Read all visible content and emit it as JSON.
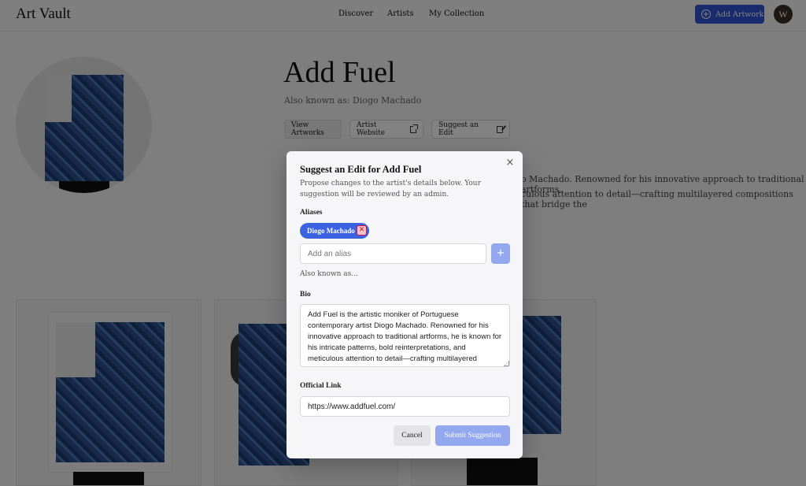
{
  "app": {
    "brand": "Art Vault",
    "avatar_initial": "W"
  },
  "nav": {
    "discover": "Discover",
    "artists": "Artists",
    "collection": "My Collection",
    "add_artwork": "Add Artwork"
  },
  "artist": {
    "name": "Add Fuel",
    "aka": "Also known as: Diogo Machado",
    "view_artworks": "View Artworks",
    "website": "Artist Website",
    "suggest_edit": "Suggest an Edit",
    "bio_visible_1": "o Machado. Renowned for his innovative approach to traditional artforms,",
    "bio_visible_2": "culous attention to detail—crafting multilayered compositions that bridge the"
  },
  "modal": {
    "title": "Suggest an Edit for Add Fuel",
    "description": "Propose changes to the artist's details below. Your suggestion will be reviewed by an admin.",
    "aliases_label": "Aliases",
    "alias_chips": [
      "Diogo Machado"
    ],
    "alias_placeholder": "Add an alias",
    "alias_add_symbol": "+",
    "alias_hint": "Also known as...",
    "bio_label": "Bio",
    "bio_value": "Add Fuel is the artistic moniker of Portuguese contemporary artist Diogo Machado. Renowned for his innovative approach to traditional artforms, he is known for his intricate patterns, bold reinterpretations, and meticulous attention to detail—crafting multilayered compositions that bridge the timeless elegance of",
    "link_label": "Official Link",
    "link_value": "https://www.addfuel.com/",
    "cancel": "Cancel",
    "submit": "Submit Suggestion",
    "close_symbol": "×"
  },
  "colors": {
    "primary": "#2f55d4",
    "chip": "#3b62e0",
    "disabled": "#93a8ef",
    "overlay": "rgba(0,0,0,0.49)"
  },
  "icons": [
    "plus-circle-icon",
    "external-link-icon",
    "edit-icon",
    "close-icon",
    "remove-icon",
    "plus-icon"
  ]
}
